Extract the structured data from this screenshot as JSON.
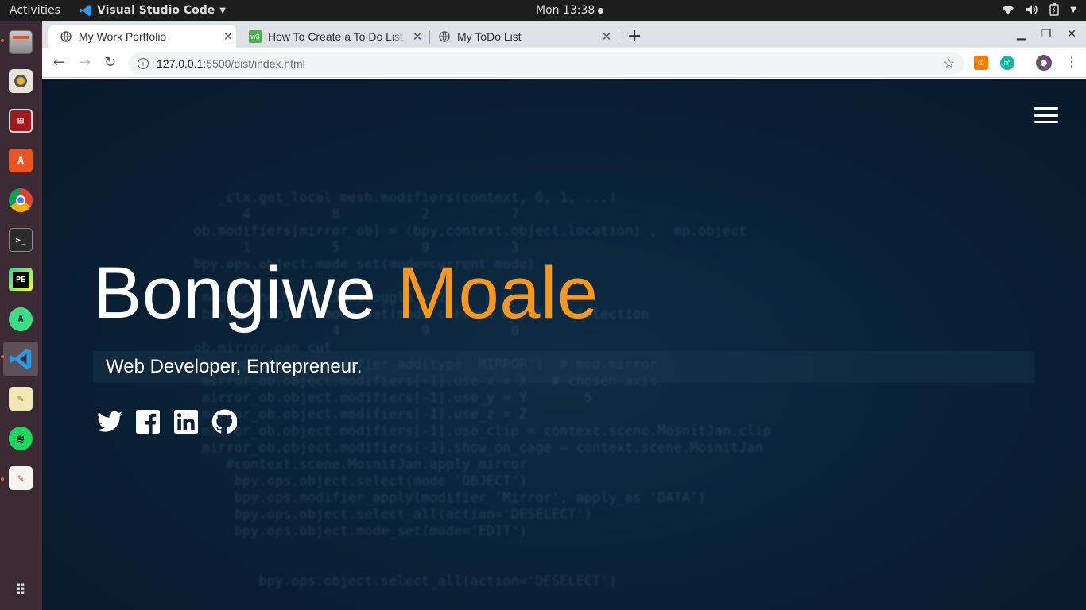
{
  "topbar": {
    "activities": "Activities",
    "app_name": "Visual Studio Code",
    "clock": "Mon 13:38"
  },
  "dock": {
    "items": [
      "files-icon",
      "rhythmbox-icon",
      "terminal-red-icon",
      "software-center-icon",
      "chrome-icon",
      "terminal-icon",
      "pycharm-icon",
      "android-studio-icon",
      "vscode-icon",
      "image-viewer-icon",
      "spotify-icon",
      "text-editor-icon",
      "app-grid-icon"
    ]
  },
  "browser": {
    "tabs": [
      {
        "title": "My Work Portfolio",
        "active": true
      },
      {
        "title": "How To Create a To Do List",
        "active": false
      },
      {
        "title": "My ToDo List",
        "active": false
      }
    ],
    "url": {
      "host": "127.0.0.1",
      "path": ":5500/dist/index.html"
    }
  },
  "page": {
    "first_name": "Bongiwe",
    "last_name": "Moale",
    "subtitle": "Web Developer, Entrepreneur.",
    "accent_color": "#f7971e",
    "socials": [
      "twitter-icon",
      "facebook-icon",
      "linkedin-icon",
      "github-icon"
    ]
  }
}
